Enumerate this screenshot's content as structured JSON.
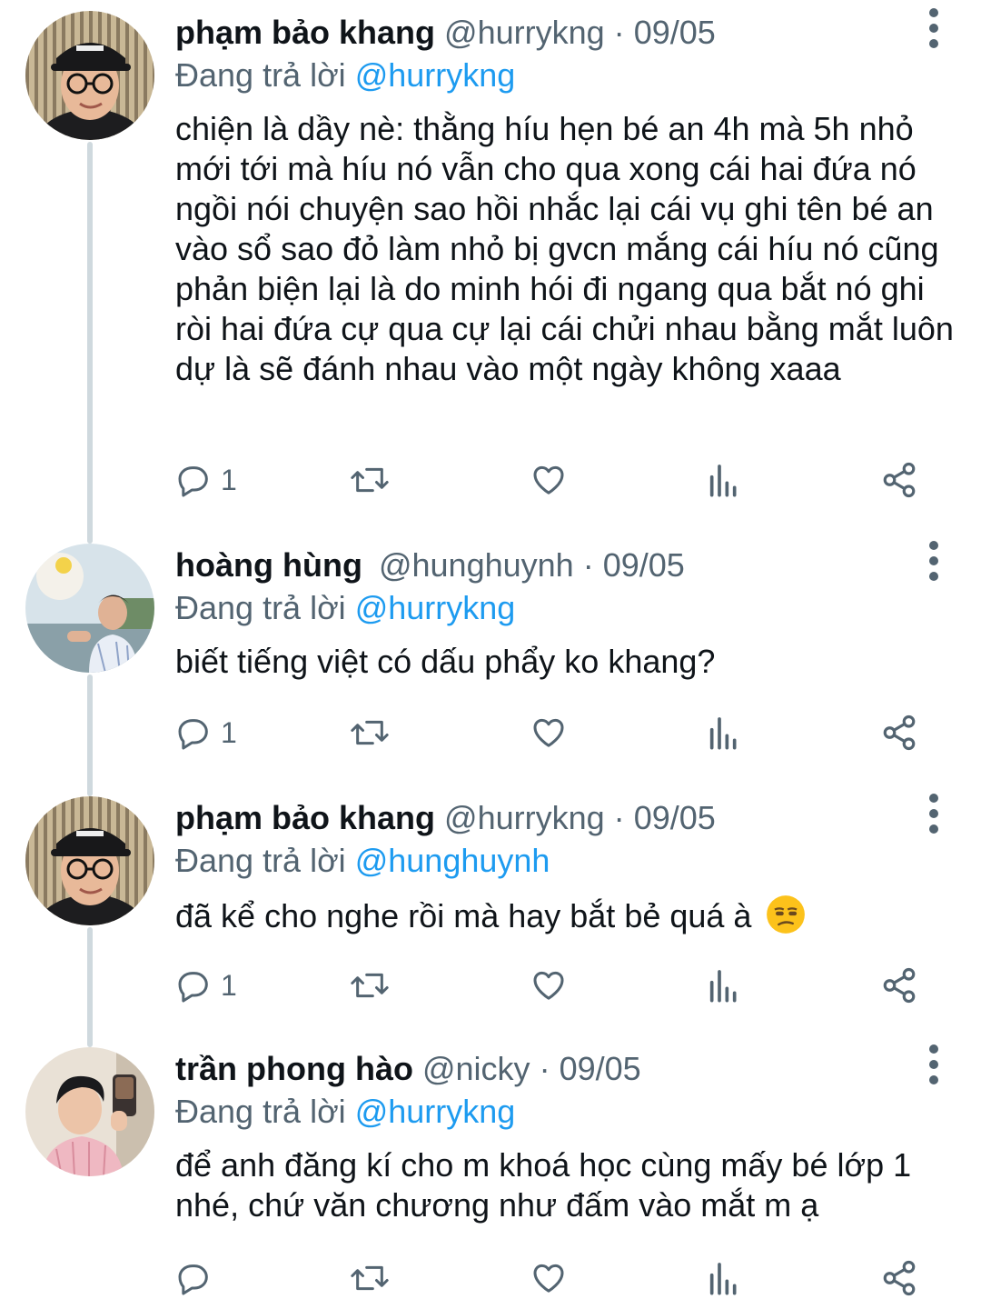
{
  "colors": {
    "link": "#1d9bf0",
    "secondary_text": "#536471",
    "primary_text": "#0f1419",
    "thread_line": "#cfd9de"
  },
  "tweets": [
    {
      "name": "phạm bảo khang",
      "handle": "@hurrykng",
      "separator": "·",
      "date": "09/05",
      "reply_prefix": "Đang trả lời",
      "reply_to": "@hurrykng",
      "text": "chiện là dầy nè: thằng híu hẹn bé an 4h mà 5h nhỏ mới tới mà híu nó vẫn cho qua xong cái hai đứa nó ngồi nói chuyện sao hồi nhắc lại cái vụ ghi tên bé an vào sổ sao đỏ làm nhỏ bị gvcn mắng cái híu nó cũng phản biện lại là do minh hói đi ngang qua bắt nó ghi ròi hai đứa cự qua cự lại cái chửi nhau bằng mắt luôn dự là sẽ đánh nhau vào một ngày không xaaa",
      "reply_count": "1",
      "avatar": "avatar-khang"
    },
    {
      "name": "hoàng hùng",
      "handle": "@hunghuynh",
      "separator": "·",
      "date": "09/05",
      "reply_prefix": "Đang trả lời",
      "reply_to": "@hurrykng",
      "text": "biết tiếng việt có dấu phẩy ko khang?",
      "reply_count": "1",
      "avatar": "avatar-hung"
    },
    {
      "name": "phạm bảo khang",
      "handle": "@hurrykng",
      "separator": "·",
      "date": "09/05",
      "reply_prefix": "Đang trả lời",
      "reply_to": "@hunghuynh",
      "text": "đã kể cho nghe rồi mà hay bắt bẻ quá à",
      "emoji": "unamused-face-emoji",
      "reply_count": "1",
      "avatar": "avatar-khang"
    },
    {
      "name": "trần phong hào",
      "handle": "@nicky",
      "separator": "·",
      "date": "09/05",
      "reply_prefix": "Đang trả lời",
      "reply_to": "@hurrykng",
      "text": "để anh đăng kí cho m khoá học cùng mấy bé lớp 1 nhé, chứ văn chương như đấm vào mắt m ạ",
      "reply_count": "",
      "avatar": "avatar-hao"
    }
  ],
  "icons": {
    "reply": "reply-icon",
    "retweet": "retweet-icon",
    "like": "like-icon",
    "analytics": "analytics-icon",
    "share": "share-icon",
    "more": "more-vertical-icon"
  }
}
